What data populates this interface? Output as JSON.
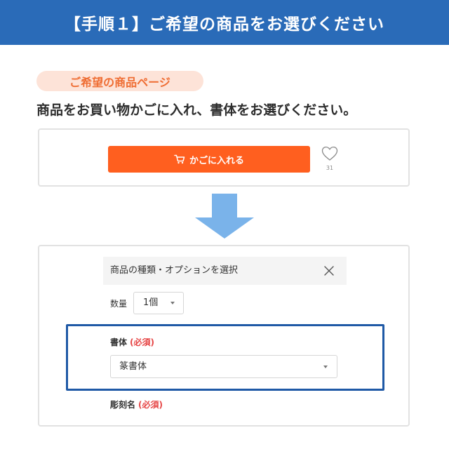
{
  "header": {
    "title": "【手順１】ご希望の商品をお選びください"
  },
  "badge": {
    "label": "ご希望の商品ページ"
  },
  "instruction": "商品をお買い物かごに入れ、書体をお選びください。",
  "cart": {
    "button_label": "かごに入れる",
    "favorite_count": "31"
  },
  "options": {
    "title": "商品の種類・オプションを選択",
    "quantity_label": "数量",
    "quantity_value": "1個",
    "font_label": "書体",
    "font_required": "(必須)",
    "font_value": "篆書体",
    "engraving_label": "彫刻名",
    "engraving_required": "(必須)"
  },
  "colors": {
    "header_bg": "#2a6bb8",
    "accent_orange": "#ff5f1f",
    "badge_bg": "#fde3d8",
    "arrow_blue": "#7ab3ea",
    "highlight_border": "#1f59a6",
    "required_red": "#e64545"
  },
  "icons": [
    "cart-icon",
    "heart-icon",
    "down-arrow-icon",
    "close-icon",
    "chevron-down-icon"
  ]
}
